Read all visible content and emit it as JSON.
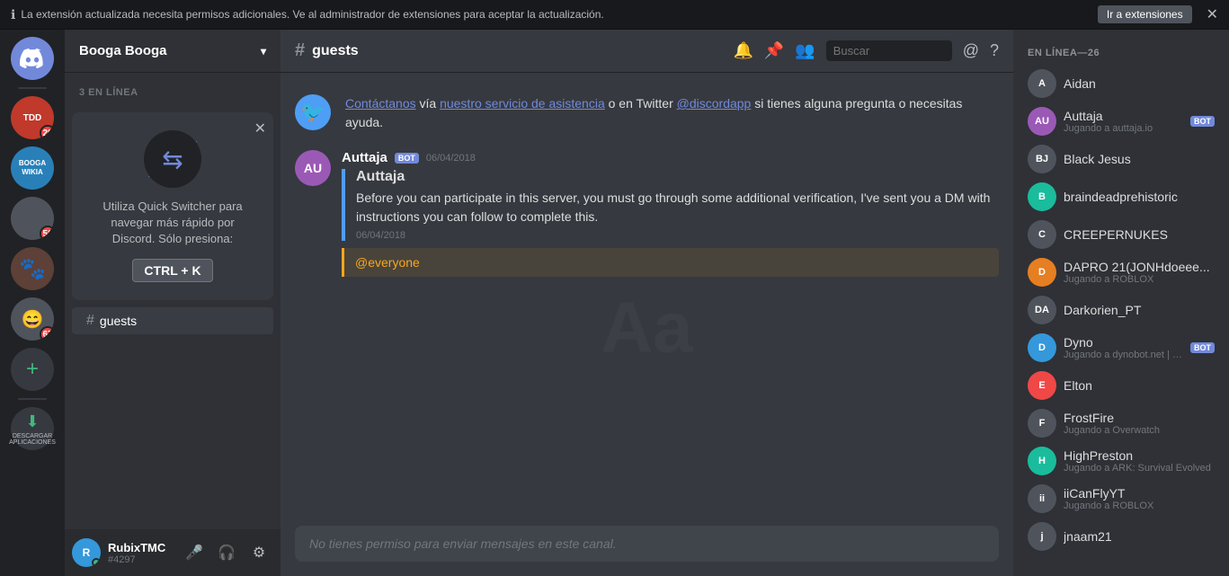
{
  "notification": {
    "text": "La extensión actualizada necesita permisos adicionales. Ve al administrador de extensiones para aceptar la actualización.",
    "button": "Ir a extensiones"
  },
  "serverList": {
    "home_label": "Discord",
    "servers": [
      {
        "id": "tdd",
        "label": "TDD",
        "badge": "20",
        "colorClass": "bg-tdd"
      },
      {
        "id": "booga",
        "label": "BOOGA BOOGA WIKIA",
        "badge": null,
        "colorClass": "bg-booga"
      },
      {
        "id": "server3",
        "label": "",
        "badge": "56",
        "colorClass": "bg-gray"
      },
      {
        "id": "server4",
        "label": "",
        "badge": null,
        "colorClass": "bg-dark"
      },
      {
        "id": "server5",
        "label": "",
        "badge": "67",
        "colorClass": "bg-gray"
      }
    ],
    "add_label": "+",
    "download_label": "DESCARGAR APLICACIONES"
  },
  "sidebar": {
    "server_name": "Booga Booga",
    "online_label": "3 EN LÍNEA",
    "channel": "guests",
    "switcher": {
      "title": "Utiliza Quick Switcher para navegar más rápido por Discord. Sólo presiona:",
      "shortcut": "CTRL + K"
    }
  },
  "userBar": {
    "name": "RubixTMC",
    "tag": "#4297",
    "initials": "R"
  },
  "chat": {
    "channel": "# guests",
    "channel_name": "guests",
    "system_message": {
      "icon": "🐦",
      "contact_text": "Contáctanos",
      "via_text": "vía",
      "service_link": "nuestro servicio de asistencia",
      "or_text": "o en Twitter",
      "twitter_link": "@discordapp",
      "suffix_text": "si tienes alguna pregunta o necesitas ayuda."
    },
    "message": {
      "author": "Auttaja",
      "bot_badge": "BOT",
      "timestamp": "06/04/2018",
      "title": "Auttaja",
      "body": "Before you can participate in this server, you must go through some additional verification, I've sent you a DM with instructions you can follow to complete this.",
      "date": "06/04/2018"
    },
    "mention": "@everyone",
    "input_placeholder": "No tienes permiso para enviar mensajes en este canal."
  },
  "members": {
    "section_label": "EN LÍNEA—26",
    "list": [
      {
        "name": "Aidan",
        "status": "",
        "colorClass": "bg-gray",
        "initials": "A",
        "bot": false
      },
      {
        "name": "Auttaja",
        "status": "Jugando a auttaja.io",
        "colorClass": "bg-purple",
        "initials": "AU",
        "bot": true
      },
      {
        "name": "Black Jesus",
        "status": "",
        "colorClass": "bg-gray",
        "initials": "BJ",
        "bot": false
      },
      {
        "name": "braindeadprehistoric",
        "status": "",
        "colorClass": "bg-teal",
        "initials": "B",
        "bot": false
      },
      {
        "name": "CREEPERNUKES",
        "status": "",
        "colorClass": "bg-gray",
        "initials": "C",
        "bot": false
      },
      {
        "name": "DAPRO 21(JONHdoeee...",
        "status": "Jugando a ROBLOX",
        "colorClass": "bg-orange",
        "initials": "D",
        "bot": false
      },
      {
        "name": "Darkorien_PT",
        "status": "",
        "colorClass": "bg-gray",
        "initials": "DA",
        "bot": false
      },
      {
        "name": "Dyno",
        "status": "Jugando a dynobot.net | ?help",
        "colorClass": "bg-blue",
        "initials": "D",
        "bot": true
      },
      {
        "name": "Elton",
        "status": "",
        "colorClass": "bg-red",
        "initials": "E",
        "bot": false
      },
      {
        "name": "FrostFire",
        "status": "Jugando a Overwatch",
        "colorClass": "bg-gray",
        "initials": "F",
        "bot": false
      },
      {
        "name": "HighPreston",
        "status": "Jugando a ARK: Survival Evolved",
        "colorClass": "bg-teal",
        "initials": "H",
        "bot": false
      },
      {
        "name": "iiCanFlyYT",
        "status": "Jugando a ROBLOX",
        "colorClass": "bg-gray",
        "initials": "ii",
        "bot": false
      },
      {
        "name": "jnaam21",
        "status": "",
        "colorClass": "bg-gray",
        "initials": "j",
        "bot": false
      }
    ]
  }
}
